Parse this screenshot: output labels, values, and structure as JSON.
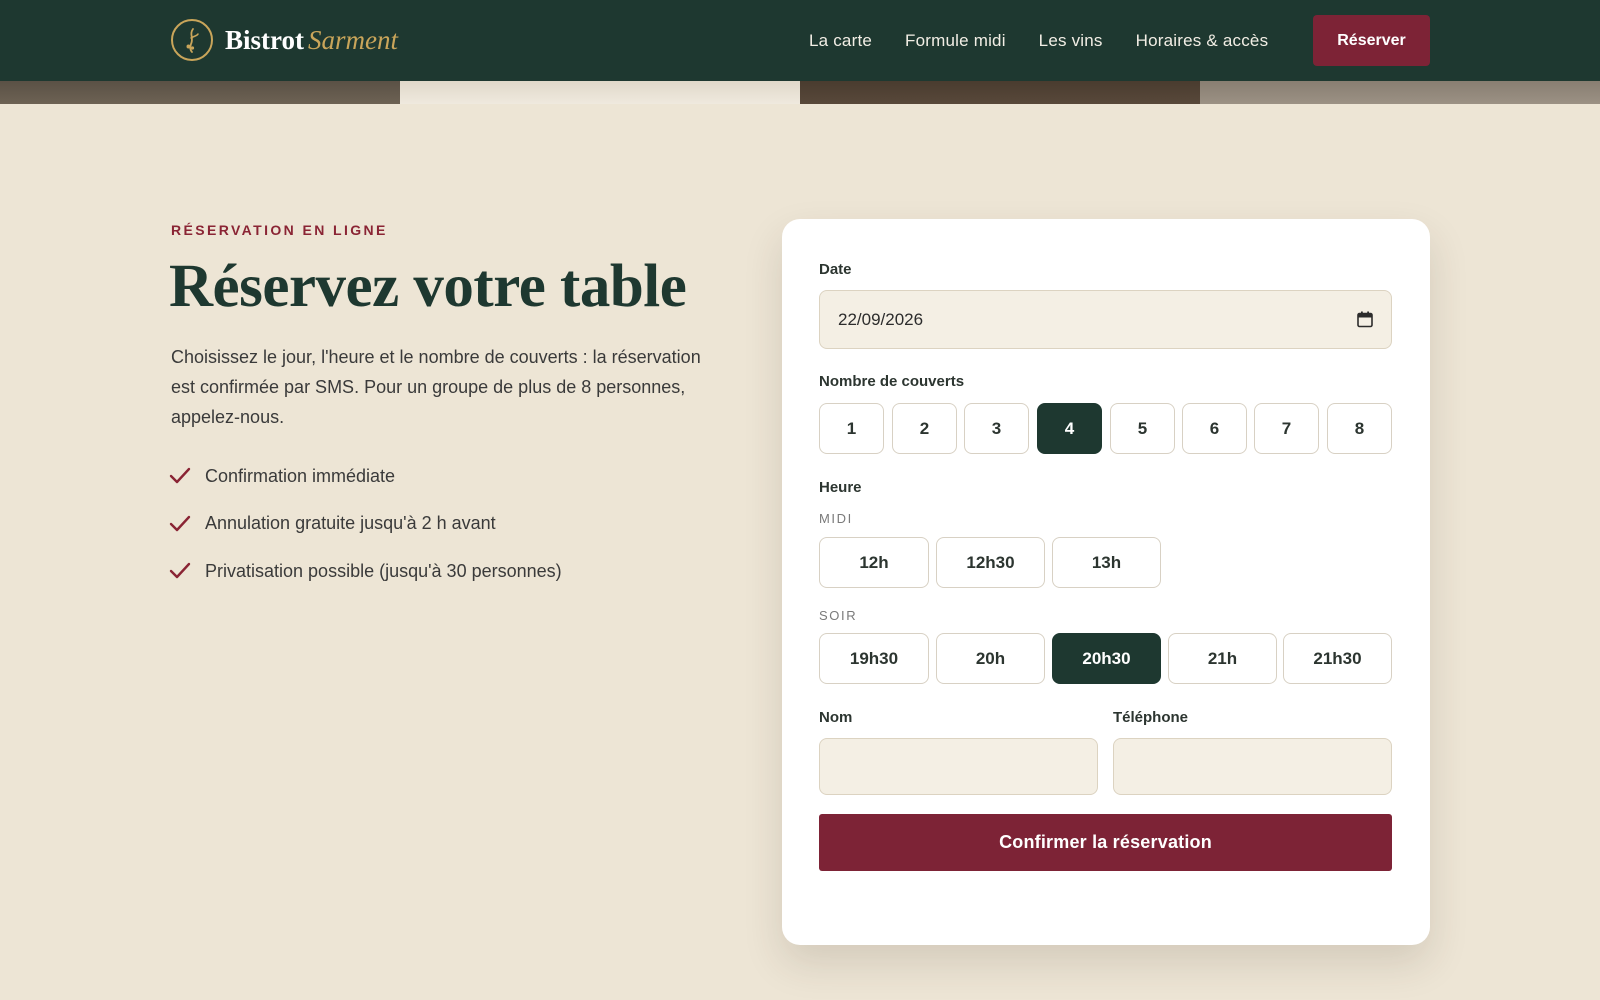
{
  "brand": {
    "name": "Bistrot",
    "name_accent": "Sarment",
    "accent_color": "#c9a55a"
  },
  "nav": {
    "items": [
      "La carte",
      "Formule midi",
      "Les vins",
      "Horaires & accès"
    ],
    "cta_label": "Réserver"
  },
  "hero": {
    "eyebrow": "RÉSERVATION EN LIGNE",
    "title": "Réservez votre table",
    "intro": "Choisissez le jour, l'heure et le nombre de couverts : la réservation est confirmée par SMS. Pour un groupe de plus de 8 personnes, appelez-nous.",
    "features": [
      "Confirmation immédiate",
      "Annulation gratuite jusqu'à 2 h avant",
      "Privatisation possible (jusqu'à 30 personnes)"
    ]
  },
  "form": {
    "date_label": "Date",
    "date_value": "22/09/2026",
    "covers_label": "Nombre de couverts",
    "covers": [
      "1",
      "2",
      "3",
      "4",
      "5",
      "6",
      "7",
      "8"
    ],
    "covers_selected": "4",
    "time_label": "Heure",
    "lunch_label": "MIDI",
    "lunch_times": [
      "12h",
      "12h30",
      "13h"
    ],
    "dinner_label": "SOIR",
    "dinner_times": [
      "19h30",
      "20h",
      "20h30",
      "21h",
      "21h30"
    ],
    "time_selected": "20h30",
    "name_label": "Nom",
    "name_value": "",
    "phone_label": "Téléphone",
    "phone_value": "",
    "submit_label": "Confirmer la réservation"
  },
  "colors": {
    "header_bg": "#1e3830",
    "primary": "#7d2336",
    "page_bg": "#ede5d5",
    "selected_bg": "#1e3830"
  }
}
